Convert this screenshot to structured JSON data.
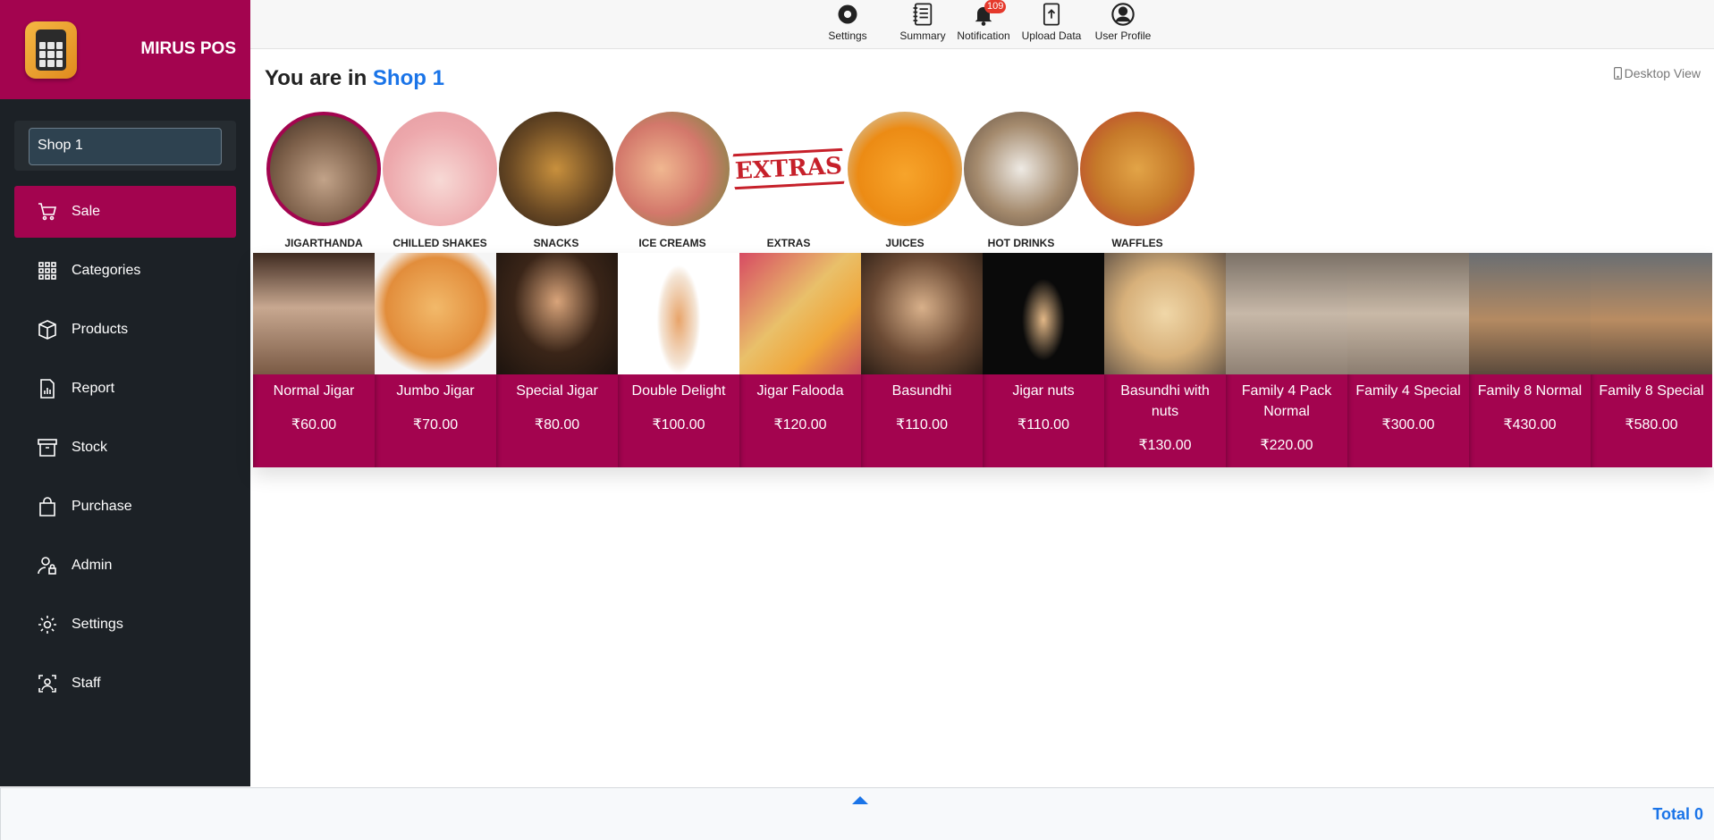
{
  "app": {
    "name": "MIRUS POS"
  },
  "sidebar": {
    "shop_value": "Shop 1",
    "items": [
      {
        "label": "Sale",
        "icon": "cart-icon",
        "active": true
      },
      {
        "label": "Categories",
        "icon": "grid-icon"
      },
      {
        "label": "Products",
        "icon": "box-icon"
      },
      {
        "label": "Report",
        "icon": "report-icon"
      },
      {
        "label": "Stock",
        "icon": "archive-icon"
      },
      {
        "label": "Purchase",
        "icon": "bag-icon"
      },
      {
        "label": "Admin",
        "icon": "admin-icon"
      },
      {
        "label": "Settings",
        "icon": "gear-icon"
      },
      {
        "label": "Staff",
        "icon": "staff-icon"
      }
    ]
  },
  "topbar": {
    "items": [
      {
        "label": "Settings",
        "icon": "gear-icon"
      },
      {
        "label": "Summary",
        "icon": "notebook-icon"
      },
      {
        "label": "Notification",
        "icon": "bell-icon",
        "badge": "109"
      },
      {
        "label": "Upload Data",
        "icon": "upload-icon"
      },
      {
        "label": "User Profile",
        "icon": "user-circle-icon"
      }
    ]
  },
  "heading": {
    "prefix": "You are in",
    "shop": "Shop 1"
  },
  "view_toggle": {
    "label": "Desktop View"
  },
  "categories": [
    {
      "name": "JIGARTHANDA",
      "active": true
    },
    {
      "name": "CHILLED SHAKES"
    },
    {
      "name": "SNACKS"
    },
    {
      "name": "ICE CREAMS"
    },
    {
      "name": "EXTRAS"
    },
    {
      "name": "JUICES"
    },
    {
      "name": "HOT DRINKS"
    },
    {
      "name": "WAFFLES"
    }
  ],
  "products": [
    {
      "name": "Normal Jigar",
      "price": "₹60.00"
    },
    {
      "name": "Jumbo Jigar",
      "price": "₹70.00"
    },
    {
      "name": "Special Jigar",
      "price": "₹80.00"
    },
    {
      "name": "Double Delight",
      "price": "₹100.00"
    },
    {
      "name": "Jigar Falooda",
      "price": "₹120.00"
    },
    {
      "name": "Basundhi",
      "price": "₹110.00"
    },
    {
      "name": "Jigar nuts",
      "price": "₹110.00"
    },
    {
      "name": "Basundhi with nuts",
      "price": "₹130.00"
    },
    {
      "name": "Family 4 Pack Normal",
      "price": "₹220.00"
    },
    {
      "name": "Family 4 Special",
      "price": "₹300.00"
    },
    {
      "name": "Family 8 Normal",
      "price": "₹430.00"
    },
    {
      "name": "Family 8 Special",
      "price": "₹580.00"
    }
  ],
  "footer": {
    "total_label": "Total 0"
  },
  "colors": {
    "brand": "#a3044f",
    "sidebar_bg": "#1c2126",
    "accent_blue": "#1a74e8"
  }
}
